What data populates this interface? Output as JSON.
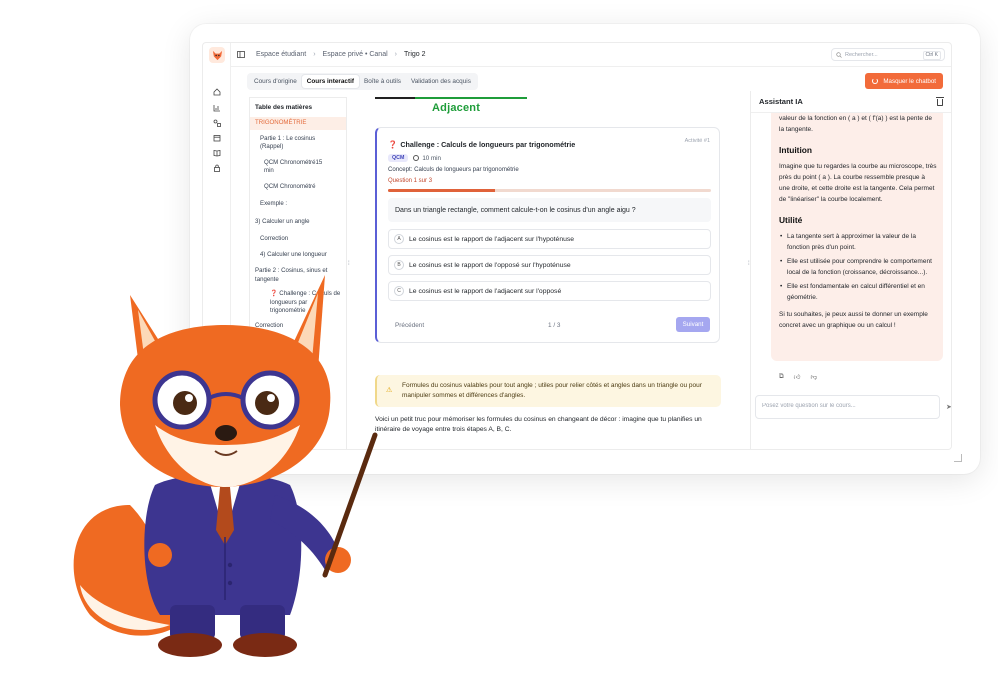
{
  "topbar": {
    "breadcrumbs": [
      "Espace étudiant",
      "Espace privé • Canal",
      "Trigo 2"
    ],
    "search_placeholder": "Rechercher...",
    "search_shortcut": "Ctrl K"
  },
  "tabs": [
    {
      "label": "Cours d'origine",
      "active": false
    },
    {
      "label": "Cours interactif",
      "active": true
    },
    {
      "label": "Boîte à outils",
      "active": false
    },
    {
      "label": "Validation des acquis",
      "active": false
    }
  ],
  "hide_chatbot_label": "Masquer le chatbot",
  "toc": {
    "title": "Table des matières",
    "items": [
      {
        "label": "TRIGONOMÉTRIE",
        "active": true
      },
      {
        "label": "Partie 1 : Le cosinus (Rappel)"
      },
      {
        "label": "QCM Chronométré15 min"
      },
      {
        "label": "QCM Chronométré"
      },
      {
        "label": "Exemple :"
      },
      {
        "label": "3) Calculer un angle"
      },
      {
        "label": "Correction"
      },
      {
        "label": "4) Calculer une longueur"
      },
      {
        "label": "Partie 2 : Cosinus, sinus et tangente"
      },
      {
        "label": "Challenge : Calculs de longueurs par trigonométrie"
      },
      {
        "label": "Correction"
      }
    ]
  },
  "main": {
    "heading": "Adjacent",
    "card": {
      "title": "Challenge : Calculs de longueurs par trigonométrie",
      "activity": "Activité #1",
      "badge": "QCM",
      "duration": "10 min",
      "concept": "Concept: Calculs de longueurs par trigonométrie",
      "question_counter": "Question 1 sur 3",
      "progress": 0.33,
      "question": "Dans un triangle rectangle, comment calcule-t-on le cosinus d'un angle aigu ?",
      "options": [
        {
          "letter": "A",
          "text": "Le cosinus est le rapport de l'adjacent sur l'hypoténuse"
        },
        {
          "letter": "B",
          "text": "Le cosinus est le rapport de l'opposé sur l'hypoténuse"
        },
        {
          "letter": "C",
          "text": "Le cosinus est le rapport de l'adjacent sur l'opposé"
        }
      ],
      "prev_label": "Précédent",
      "page": "1 / 3",
      "next_label": "Suivant"
    },
    "note": "Formules du cosinus valables pour tout angle ; utiles pour relier côtés et angles dans un triangle ou pour manipuler sommes et différences d'angles.",
    "paragraph": "Voici un petit truc pour mémoriser les formules du cosinus en changeant de décor : imagine que tu planifies un itinéraire de voyage entre trois étapes A, B, C."
  },
  "assistant": {
    "title": "Assistant IA",
    "intro": "valeur de la fonction en ( a ) et ( f'(a) ) est la pente de la tangente.",
    "intuition_heading": "Intuition",
    "intuition_text": "Imagine que tu regardes la courbe au microscope, très près du point ( a ). La courbe ressemble presque à une droite, et cette droite est la tangente. Cela permet de \"linéariser\" la courbe localement.",
    "utility_heading": "Utilité",
    "utility_items": [
      "La tangente sert à approximer la valeur de la fonction près d'un point.",
      "Elle est utilisée pour comprendre le comportement local de la fonction (croissance, décroissance...).",
      "Elle est fondamentale en calcul différentiel et en géométrie."
    ],
    "closing": "Si tu souhaites, je peux aussi te donner un exemple concret avec un graphique ou un calcul !",
    "input_placeholder": "Posez votre question sur le cours..."
  },
  "colors": {
    "accent": "#f26b3a",
    "primary": "#5b5fd6",
    "green": "#1f9d3a"
  }
}
